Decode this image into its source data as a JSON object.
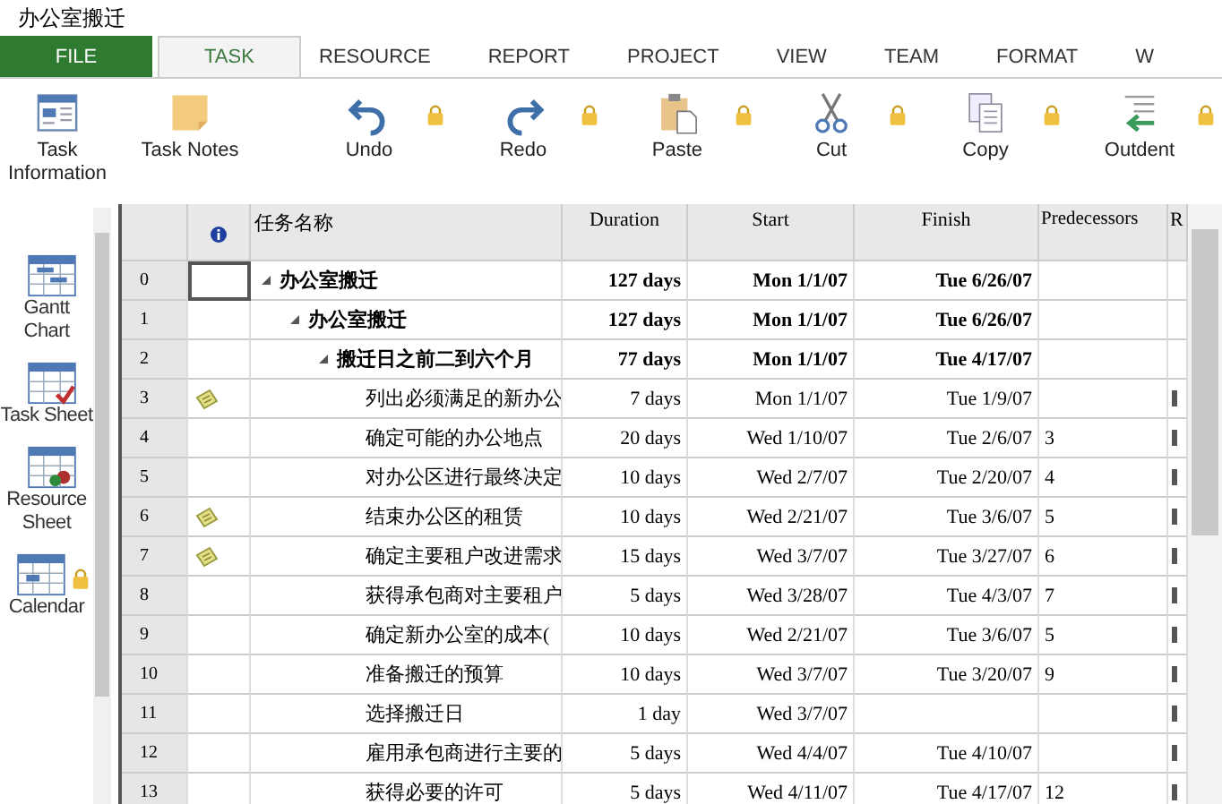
{
  "window": {
    "title": "办公室搬迁"
  },
  "tabs": [
    {
      "label": "FILE",
      "kind": "file",
      "selected": false
    },
    {
      "label": "TASK",
      "kind": "tab",
      "selected": true
    },
    {
      "label": "RESOURCE",
      "kind": "tab",
      "selected": false
    },
    {
      "label": "REPORT",
      "kind": "tab",
      "selected": false
    },
    {
      "label": "PROJECT",
      "kind": "tab",
      "selected": false
    },
    {
      "label": "VIEW",
      "kind": "tab",
      "selected": false
    },
    {
      "label": "TEAM",
      "kind": "tab",
      "selected": false
    },
    {
      "label": "FORMAT",
      "kind": "tab",
      "selected": false
    },
    {
      "label": "W",
      "kind": "tab",
      "selected": false
    }
  ],
  "ribbon": [
    {
      "label": "Task Information",
      "kind": "info",
      "locked": false
    },
    {
      "label": "Task Notes",
      "kind": "notes",
      "locked": false
    },
    {
      "label": "Undo",
      "kind": "undo",
      "locked": true
    },
    {
      "label": "Redo",
      "kind": "redo",
      "locked": true
    },
    {
      "label": "Paste",
      "kind": "paste",
      "locked": true
    },
    {
      "label": "Cut",
      "kind": "cut",
      "locked": true
    },
    {
      "label": "Copy",
      "kind": "copy",
      "locked": true
    },
    {
      "label": "Outdent",
      "kind": "outdent",
      "locked": true
    }
  ],
  "sidebar": {
    "items": [
      {
        "label": "Gantt Chart",
        "kind": "gantt",
        "locked": false
      },
      {
        "label": "Task Sheet",
        "kind": "task",
        "locked": false
      },
      {
        "label": "Resource Sheet",
        "kind": "resource",
        "locked": false
      },
      {
        "label": "Calendar",
        "kind": "calendar",
        "locked": true
      }
    ]
  },
  "table": {
    "columns": [
      "任务名称",
      "Duration",
      "Start",
      "Finish",
      "Predecessors",
      "R"
    ],
    "rows": [
      {
        "id": "0",
        "name": "办公室搬迁",
        "duration": "127 days",
        "start": "Mon 1/1/07",
        "finish": "Tue 6/26/07",
        "note": false,
        "resource_mark": false,
        "expanded": true,
        "selected": true,
        "children": [
          {
            "id": "1",
            "name": "办公室搬迁",
            "duration": "127 days",
            "start": "Mon 1/1/07",
            "finish": "Tue 6/26/07",
            "note": false,
            "resource_mark": false,
            "expanded": true,
            "selected": false,
            "children": [
              {
                "id": "2",
                "name": "搬迁日之前二到六个月",
                "duration": "77 days",
                "start": "Mon 1/1/07",
                "finish": "Tue 4/17/07",
                "note": false,
                "resource_mark": false,
                "expanded": true,
                "selected": false,
                "children": [
                  {
                    "id": "3",
                    "name": "列出必须满足的新办公",
                    "duration": "7 days",
                    "start": "Mon 1/1/07",
                    "finish": "Tue 1/9/07",
                    "note": true,
                    "resource_mark": true,
                    "selected": false
                  },
                  {
                    "id": "4",
                    "name": "确定可能的办公地点",
                    "duration": "20 days",
                    "start": "Wed 1/10/07",
                    "finish": "Tue 2/6/07",
                    "predecessors": "3",
                    "note": false,
                    "resource_mark": true,
                    "selected": false
                  },
                  {
                    "id": "5",
                    "name": "对办公区进行最终决定",
                    "duration": "10 days",
                    "start": "Wed 2/7/07",
                    "finish": "Tue 2/20/07",
                    "predecessors": "4",
                    "note": false,
                    "resource_mark": true,
                    "selected": false
                  },
                  {
                    "id": "6",
                    "name": "结束办公区的租赁",
                    "duration": "10 days",
                    "start": "Wed 2/21/07",
                    "finish": "Tue 3/6/07",
                    "predecessors": "5",
                    "note": true,
                    "resource_mark": true,
                    "selected": false
                  },
                  {
                    "id": "7",
                    "name": "确定主要租户改进需求",
                    "duration": "15 days",
                    "start": "Wed 3/7/07",
                    "finish": "Tue 3/27/07",
                    "predecessors": "6",
                    "note": true,
                    "resource_mark": true,
                    "selected": false
                  },
                  {
                    "id": "8",
                    "name": "获得承包商对主要租户",
                    "duration": "5 days",
                    "start": "Wed 3/28/07",
                    "finish": "Tue 4/3/07",
                    "predecessors": "7",
                    "note": false,
                    "resource_mark": true,
                    "selected": false
                  },
                  {
                    "id": "9",
                    "name": "确定新办公室的成本(",
                    "duration": "10 days",
                    "start": "Wed 2/21/07",
                    "finish": "Tue 3/6/07",
                    "predecessors": "5",
                    "note": false,
                    "resource_mark": true,
                    "selected": false
                  },
                  {
                    "id": "10",
                    "name": "准备搬迁的预算",
                    "duration": "10 days",
                    "start": "Wed 3/7/07",
                    "finish": "Tue 3/20/07",
                    "predecessors": "9",
                    "note": false,
                    "resource_mark": true,
                    "selected": false
                  },
                  {
                    "id": "11",
                    "name": "选择搬迁日",
                    "duration": "1 day",
                    "start": "Wed 3/7/07",
                    "note": false,
                    "resource_mark": true,
                    "selected": false
                  },
                  {
                    "id": "12",
                    "name": "雇用承包商进行主要的",
                    "duration": "5 days",
                    "start": "Wed 4/4/07",
                    "finish": "Tue 4/10/07",
                    "note": false,
                    "resource_mark": true,
                    "selected": false
                  },
                  {
                    "id": "13",
                    "name": "获得必要的许可",
                    "duration": "5 days",
                    "start": "Wed 4/11/07",
                    "finish": "Tue 4/17/07",
                    "predecessors": "12",
                    "note": false,
                    "resource_mark": true,
                    "selected": false
                  }
                ]
              }
            ]
          }
        ]
      }
    ]
  }
}
